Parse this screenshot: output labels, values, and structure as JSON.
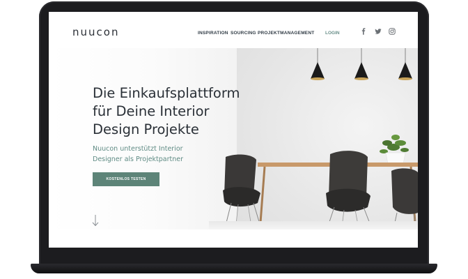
{
  "site": {
    "logo": "nuucon",
    "nav": {
      "items": [
        {
          "label": "INSPIRATION"
        },
        {
          "label": "SOURCING"
        },
        {
          "label": "PROJEKTMANAGEMENT"
        }
      ],
      "login": "LOGIN"
    },
    "social": [
      {
        "icon": "facebook-icon"
      },
      {
        "icon": "twitter-icon"
      },
      {
        "icon": "instagram-icon"
      }
    ]
  },
  "hero": {
    "title_lines": [
      "Die Einkaufsplattform",
      "für Deine Interior",
      "Design Projekte"
    ],
    "subtitle_lines": [
      "Nuucon unterstützt Interior",
      "Designer als Projektpartner"
    ],
    "cta_label": "KOSTENLOS TESTEN",
    "scroll_icon": "arrow-down-icon"
  },
  "colors": {
    "accent": "#5d8478",
    "subtitle": "#5f8b84",
    "text_dark": "#2a3037",
    "device": "#1c1c1f"
  }
}
